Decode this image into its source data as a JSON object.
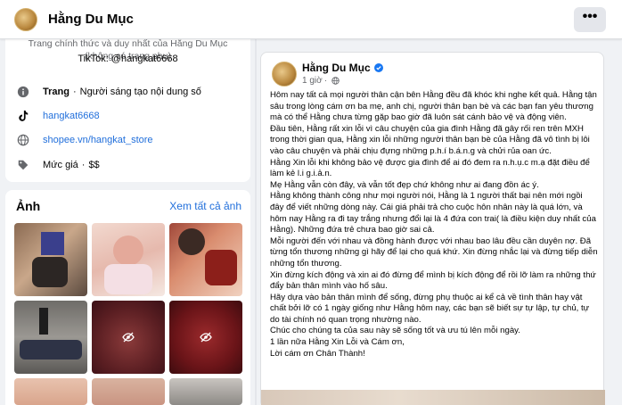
{
  "header": {
    "page_name": "Hằng Du Mục",
    "more_label": "•••"
  },
  "intro": {
    "description": "Trang chính thức và duy nhất của Hằng Du Mục (không có trang phụ)",
    "tiktok_line": "TikTok: @hangkat6668",
    "page_label": "Trang",
    "page_category": "Người sáng tạo nội dung số",
    "tiktok_handle": "hangkat6668",
    "shopee_link": "shopee.vn/hangkat_store",
    "price_label": "Mức giá",
    "price_value": "$$"
  },
  "photos": {
    "title": "Ảnh",
    "see_all": "Xem tất cả ảnh"
  },
  "post": {
    "author": "Hằng Du Mục",
    "time": "1 giờ",
    "body": [
      "Hôm nay tất cả mọi người thân cận bên Hằng đều đã khóc khi nghe kết quả. Hằng tận sâu trong lòng cám ơn ba mẹ, anh chị, người thân bạn bè và các bạn fan yêu thương mà có thể Hằng chưa từng gặp bao giờ đã luôn sát cánh bảo vệ và động viên.",
      "Đầu tiên, Hằng rất xin lỗi vì câu chuyện của gia đình Hằng đã gây rối ren trên MXH trong thời gian qua, Hằng xin lỗi những người thân bạn bè của Hằng đã vô tình bị lôi vào câu chuyện và phải chịu đựng những p.h.í b.á.n.g và chửi rủa oan ức.",
      "Hằng Xin lỗi khi không bảo vệ được gia đình để ai đó đem ra n.h.ụ.c m.ạ đặt điều để làm kẻ l.i g.i.ả.n.",
      "Mẹ Hằng vẫn còn đây, và vẫn tốt đẹp chứ không như ai đang đồn ác ý.",
      "Hằng không thành công như mọi người nói, Hằng là 1 người thất bại nên mới ngồi đây để viết những dòng này. Cái giá phải trả cho cuộc hôn nhân này là quá lớn, và hôm nay Hằng ra đi tay trắng nhưng đổi lại là 4 đứa con trai( là điều kiện duy nhất của Hằng). Những đứa trẻ chưa bao giờ sai cả.",
      "Mỗi người đến với nhau và đồng hành được với nhau bao lâu đều cần duyên nợ. Đã từng tổn thương những gì hãy để lại cho quá khứ. Xin đừng nhắc lại và đừng tiếp diễn những tổn thương.",
      "Xin đừng kích động và xin ai đó đừng để mình bị kích động để rồi lỡ làm ra những thứ đẩy bản thân mình vào hố sâu.",
      "Hãy dựa vào bản thân mình để sống, đừng phụ thuộc ai kể cả về tình thân hay vật chất bởi lỡ có 1 ngày giống như Hằng hôm nay, các bạn sẽ biết sự tự lập, tự chủ, tự do tài chính nó quan trọng nhường nào.",
      "Chúc cho chúng ta của sau này sẽ sống tốt và ưu tú lên mỗi ngày.",
      "1 lần nữa Hằng Xin Lỗi và Cám ơn,",
      "Lời cám ơn Chân Thành!"
    ]
  },
  "colors": {
    "link": "#216fdb",
    "accent": "#1877f2",
    "background": "#f0f2f5"
  }
}
